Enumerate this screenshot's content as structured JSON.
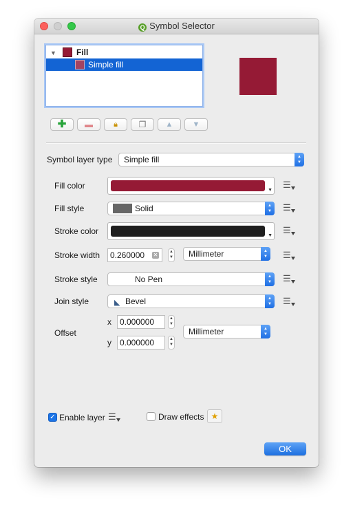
{
  "window": {
    "title": "Symbol Selector"
  },
  "colors": {
    "fill": "#951a35",
    "stroke": "#1e1e1e",
    "accent": "#1c6fe0"
  },
  "symbol_tree": {
    "items": [
      {
        "label": "Fill",
        "expanded": true,
        "selected": false
      },
      {
        "label": "Simple fill",
        "selected": true
      }
    ]
  },
  "layer_toolbar": {
    "buttons": [
      "add-layer-icon",
      "remove-layer-icon",
      "lock-layer-icon",
      "duplicate-layer-icon",
      "move-up-icon",
      "move-down-icon"
    ]
  },
  "symbol_layer_type": {
    "label": "Symbol layer type",
    "value": "Simple fill"
  },
  "properties": {
    "fill_color": {
      "label": "Fill color"
    },
    "fill_style": {
      "label": "Fill style",
      "value": "Solid"
    },
    "stroke_color": {
      "label": "Stroke color"
    },
    "stroke_width": {
      "label": "Stroke width",
      "value": "0.260000",
      "unit": "Millimeter"
    },
    "stroke_style": {
      "label": "Stroke style",
      "value": "No Pen"
    },
    "join_style": {
      "label": "Join style",
      "value": "Bevel"
    },
    "offset": {
      "label": "Offset",
      "x_label": "x",
      "x_value": "0.000000",
      "y_label": "y",
      "y_value": "0.000000",
      "unit": "Millimeter"
    }
  },
  "footer": {
    "enable_layer": {
      "label": "Enable layer",
      "checked": true
    },
    "draw_effects": {
      "label": "Draw effects",
      "checked": false
    },
    "ok_label": "OK"
  }
}
